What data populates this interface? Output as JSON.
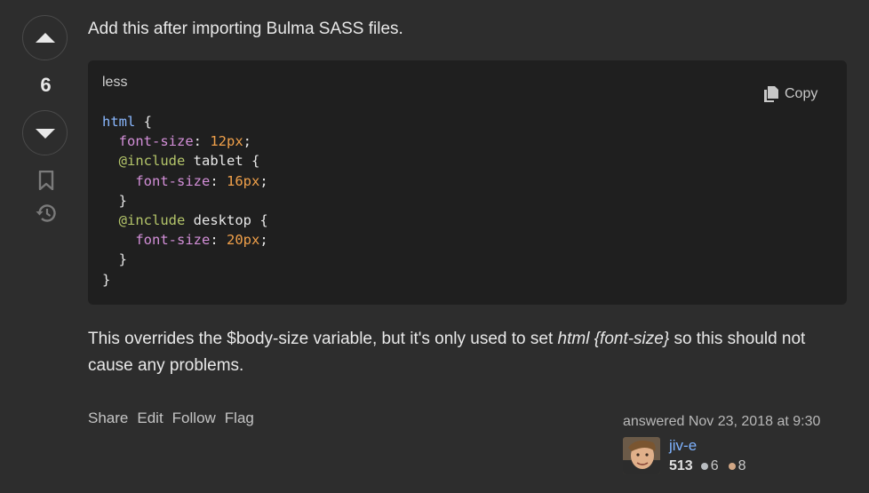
{
  "vote": {
    "score": "6",
    "upvote_icon": "arrow-up-icon",
    "downvote_icon": "arrow-down-icon",
    "bookmark_icon": "bookmark-icon",
    "history_icon": "history-icon"
  },
  "post": {
    "intro": "Add this after importing Bulma SASS files.",
    "code_language": "less",
    "copy_label": "Copy",
    "code_lines": [
      "html {",
      "  font-size: 12px;",
      "  @include tablet {",
      "    font-size: 16px;",
      "  }",
      "  @include desktop {",
      "    font-size: 20px;",
      "  }",
      "}"
    ],
    "outro_before": "This overrides the $body-size variable, but it's only used to set ",
    "outro_em": "html {font-size}",
    "outro_after": " so this should not cause any problems."
  },
  "menu": {
    "share": "Share",
    "edit": "Edit",
    "follow": "Follow",
    "flag": "Flag"
  },
  "signature": {
    "action": "answered Nov 23, 2018 at 9:30",
    "username": "jiv-e",
    "reputation": "513",
    "silver": "6",
    "bronze": "8"
  },
  "colors": {
    "background": "#2d2d2d",
    "code_bg": "#1f1f1f",
    "link": "#7fb3ff",
    "silver": "#b8bcc0",
    "bronze": "#d1a684"
  }
}
